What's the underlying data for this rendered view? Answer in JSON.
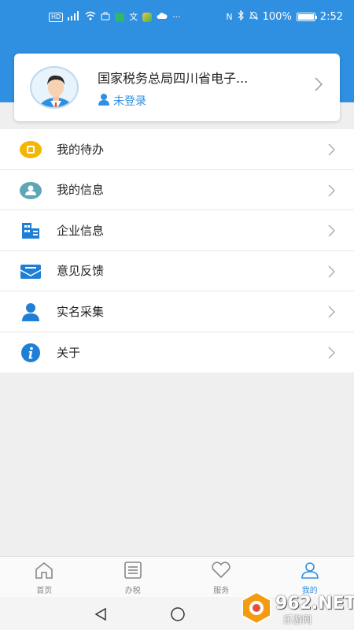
{
  "status_bar": {
    "hd": "HD",
    "signal": "4G",
    "nfc": "N",
    "battery_percent": "100%",
    "time": "2:52"
  },
  "profile": {
    "org_name": "国家税务总局四川省电子...",
    "login_status": "未登录"
  },
  "menu": [
    {
      "label": "我的待办",
      "icon": "todo-icon",
      "color": "#f2b705"
    },
    {
      "label": "我的信息",
      "icon": "user-info-icon",
      "color": "#5ba7b6"
    },
    {
      "label": "企业信息",
      "icon": "building-icon",
      "color": "#1e7fd6"
    },
    {
      "label": "意见反馈",
      "icon": "feedback-mail-icon",
      "color": "#1e7fd6"
    },
    {
      "label": "实名采集",
      "icon": "person-icon",
      "color": "#1e7fd6"
    },
    {
      "label": "关于",
      "icon": "info-icon",
      "color": "#1e7fd6"
    }
  ],
  "tabs": [
    {
      "label": "首页",
      "icon": "home-icon",
      "active": false
    },
    {
      "label": "办税",
      "icon": "list-icon",
      "active": false
    },
    {
      "label": "服务",
      "icon": "heart-icon",
      "active": false
    },
    {
      "label": "我的",
      "icon": "user-icon",
      "active": true
    }
  ],
  "watermark": {
    "text": "962.NET",
    "sub": "乐游网"
  },
  "colors": {
    "primary": "#2f8fe0",
    "background": "#efefef"
  }
}
